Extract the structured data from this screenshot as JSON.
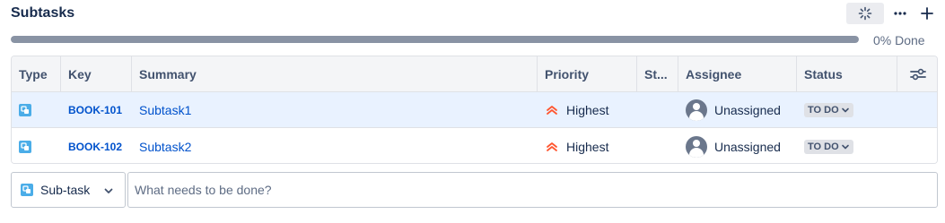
{
  "header": {
    "title": "Subtasks",
    "ai_icon": "sparkle-icon",
    "more_icon": "more-horizontal-icon",
    "add_icon": "plus-icon"
  },
  "progress": {
    "percent_done": 0,
    "label": "0% Done"
  },
  "table": {
    "columns": [
      "Type",
      "Key",
      "Summary",
      "Priority",
      "St...",
      "Assignee",
      "Status"
    ],
    "settings_icon": "column-settings-icon",
    "rows": [
      {
        "type_icon": "subtask-icon",
        "key": "BOOK-101",
        "summary": "Subtask1",
        "priority": "Highest",
        "priority_icon": "priority-highest-icon",
        "story_points": "",
        "assignee": "Unassigned",
        "status": "TO DO"
      },
      {
        "type_icon": "subtask-icon",
        "key": "BOOK-102",
        "summary": "Subtask2",
        "priority": "Highest",
        "priority_icon": "priority-highest-icon",
        "story_points": "",
        "assignee": "Unassigned",
        "status": "TO DO"
      }
    ]
  },
  "create": {
    "issue_type": "Sub-task",
    "placeholder": "What needs to be done?",
    "value": ""
  },
  "colors": {
    "link": "#0052cc",
    "selected_row": "#e9f2ff",
    "priority_highest": "#ff5630",
    "subtask_icon": "#4bade8"
  }
}
